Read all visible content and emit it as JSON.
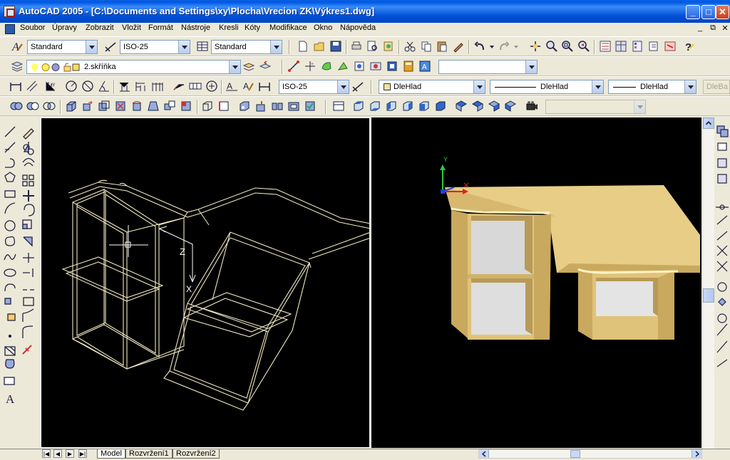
{
  "window": {
    "title": "AutoCAD 2005 - [C:\\Documents and Settings\\xy\\Plocha\\Vrecion ZK\\Výkres1.dwg]",
    "controls": [
      "_",
      "□",
      "✕"
    ],
    "mdi_controls": [
      "_",
      "⧉",
      "✕"
    ]
  },
  "menu": [
    "Soubor",
    "Úpravy",
    "Zobrazit",
    "Vložit",
    "Formát",
    "Nástroje",
    "Kresli",
    "Kóty",
    "Modifikace",
    "Okno",
    "Nápověda"
  ],
  "toolbar1": {
    "text_style": "Standard",
    "dim_style": "ISO-25",
    "table_style": "Standard",
    "extra_combo": ""
  },
  "toolbar2": {
    "layer": "2.skříňka",
    "extra_combo": ""
  },
  "toolbar3": {
    "dim_style": "ISO-25",
    "color": "DleHlad",
    "linetype": "DleHlad",
    "lineweight": "DleHlad",
    "plot_style": "DleBa"
  },
  "toolbar4": {
    "extra_combo": ""
  },
  "viewport_left": {
    "ucs_labels": {
      "z": "Z",
      "x": "X"
    }
  },
  "viewport_right": {
    "ucs_labels": {
      "y": "Y"
    }
  },
  "tabs": {
    "nav": [
      "|◀",
      "◀",
      "▶",
      "▶|"
    ],
    "items": [
      "Model",
      "Rozvržení1",
      "Rozvržení2"
    ],
    "active": "Model"
  },
  "colors": {
    "title_bar": "#0058e6",
    "shaded_desk": "#e8cd86",
    "wireframe": "#f0e8c0"
  }
}
